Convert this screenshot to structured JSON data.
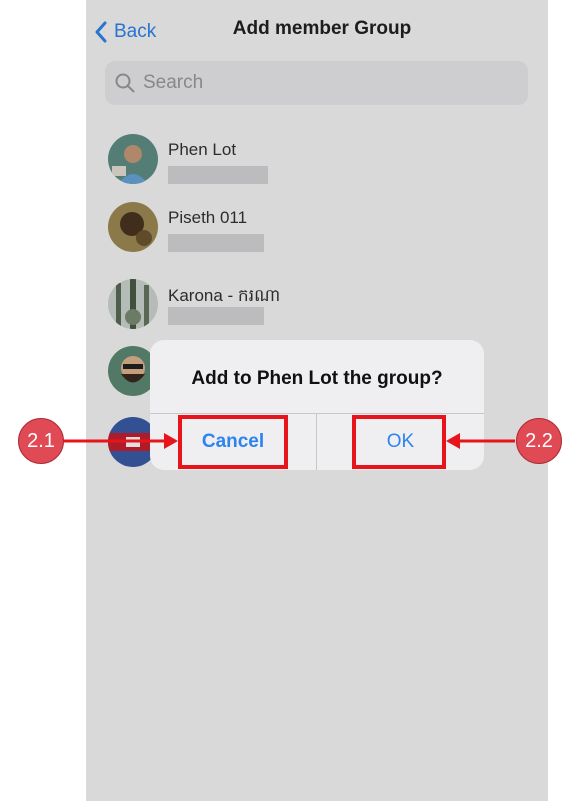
{
  "nav": {
    "back_label": "Back",
    "title": "Add member Group"
  },
  "search": {
    "placeholder": "Search"
  },
  "contacts": [
    {
      "name": "Phen Lot"
    },
    {
      "name": "Piseth 011"
    },
    {
      "name": "Karona - ករណា"
    },
    {
      "name": ""
    },
    {
      "name": ""
    }
  ],
  "dialog": {
    "message": "Add to Phen Lot the group?",
    "cancel_label": "Cancel",
    "ok_label": "OK"
  },
  "annotations": [
    {
      "label": "2.1",
      "target": "cancel"
    },
    {
      "label": "2.2",
      "target": "ok"
    }
  ],
  "colors": {
    "accent": "#2d84ee",
    "highlight": "#e8141b",
    "badge": "#e04a55"
  },
  "icons": [
    "chevron-left-icon",
    "search-icon"
  ]
}
